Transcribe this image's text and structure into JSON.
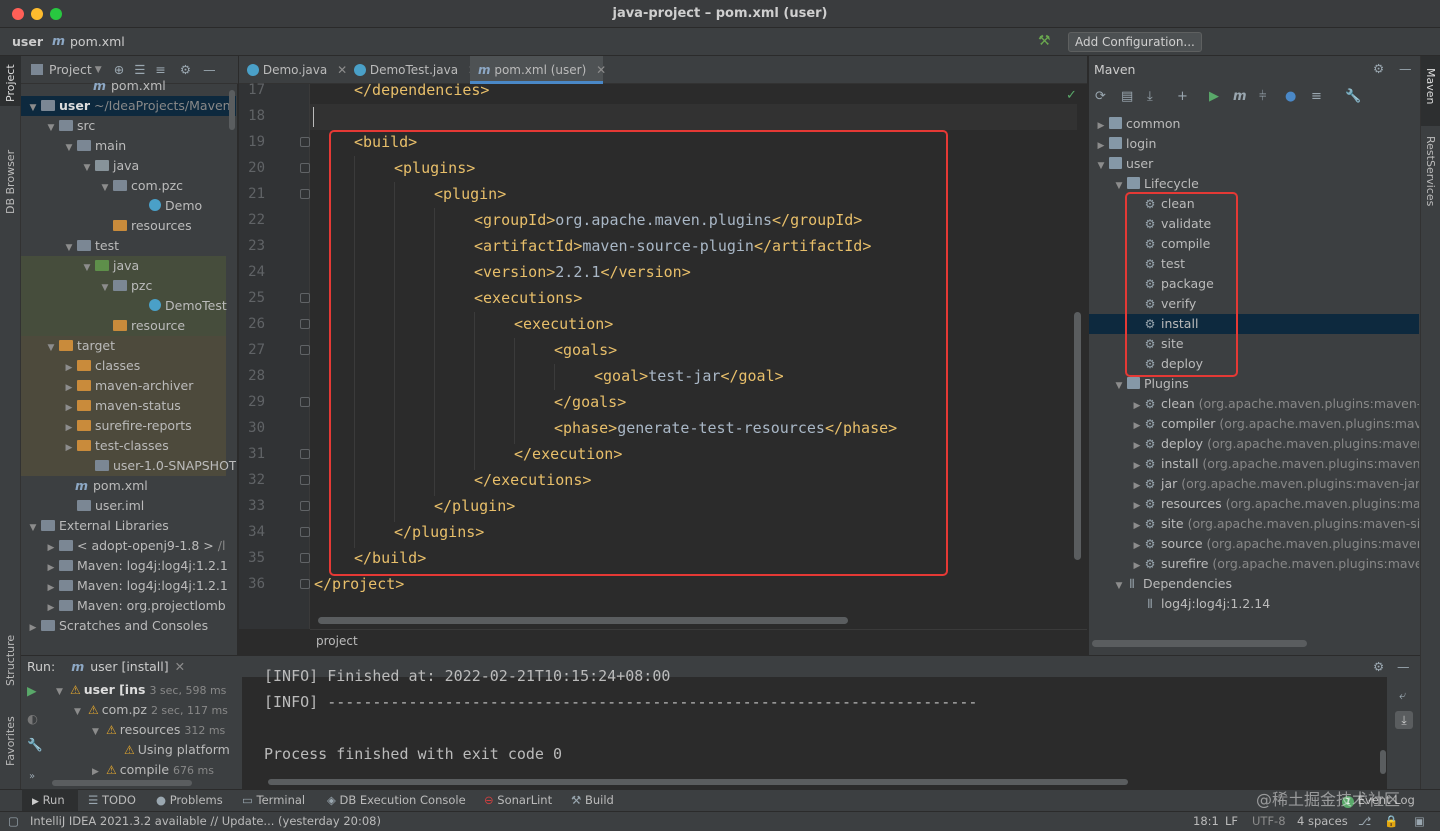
{
  "window": {
    "title": "java-project – pom.xml (user)"
  },
  "navbar": {
    "project": "user",
    "file": "pom.xml",
    "add_configuration": "Add Configuration..."
  },
  "left_stripe": {
    "project": "Project",
    "db_browser": "DB Browser",
    "structure": "Structure",
    "favorites": "Favorites"
  },
  "project_panel": {
    "title": "Project",
    "items": [
      {
        "label": "pom.xml",
        "extra": ""
      },
      {
        "label": "user",
        "extra": "~/IdeaProjects/Maven"
      },
      {
        "label": "src",
        "extra": ""
      },
      {
        "label": "main",
        "extra": ""
      },
      {
        "label": "java",
        "extra": ""
      },
      {
        "label": "com.pzc",
        "extra": ""
      },
      {
        "label": "Demo",
        "extra": ""
      },
      {
        "label": "resources",
        "extra": ""
      },
      {
        "label": "test",
        "extra": ""
      },
      {
        "label": "java",
        "extra": ""
      },
      {
        "label": "pzc",
        "extra": ""
      },
      {
        "label": "DemoTest",
        "extra": ""
      },
      {
        "label": "resource",
        "extra": ""
      },
      {
        "label": "target",
        "extra": ""
      },
      {
        "label": "classes",
        "extra": ""
      },
      {
        "label": "maven-archiver",
        "extra": ""
      },
      {
        "label": "maven-status",
        "extra": ""
      },
      {
        "label": "surefire-reports",
        "extra": ""
      },
      {
        "label": "test-classes",
        "extra": ""
      },
      {
        "label": "user-1.0-SNAPSHOT",
        "extra": ""
      },
      {
        "label": "pom.xml",
        "extra": ""
      },
      {
        "label": "user.iml",
        "extra": ""
      },
      {
        "label": "External Libraries",
        "extra": ""
      },
      {
        "label": "< adopt-openj9-1.8 >",
        "extra": "/l"
      },
      {
        "label": "Maven: log4j:log4j:1.2.1",
        "extra": ""
      },
      {
        "label": "Maven: log4j:log4j:1.2.1",
        "extra": ""
      },
      {
        "label": "Maven: org.projectlomb",
        "extra": ""
      },
      {
        "label": "Scratches and Consoles",
        "extra": ""
      }
    ]
  },
  "editor": {
    "tabs": [
      {
        "label": "Demo.java"
      },
      {
        "label": "DemoTest.java"
      },
      {
        "label": "pom.xml (user)"
      }
    ],
    "lines": [
      {
        "n": "17",
        "text": "</dependencies>"
      },
      {
        "n": "18",
        "text": ""
      },
      {
        "n": "19",
        "text": "<build>"
      },
      {
        "n": "20",
        "text": "<plugins>"
      },
      {
        "n": "21",
        "text": "<plugin>"
      },
      {
        "n": "22",
        "text": "<groupId>org.apache.maven.plugins</groupId>"
      },
      {
        "n": "23",
        "text": "<artifactId>maven-source-plugin</artifactId>"
      },
      {
        "n": "24",
        "text": "<version>2.2.1</version>"
      },
      {
        "n": "25",
        "text": "<executions>"
      },
      {
        "n": "26",
        "text": "<execution>"
      },
      {
        "n": "27",
        "text": "<goals>"
      },
      {
        "n": "28",
        "text": "<goal>test-jar</goal>"
      },
      {
        "n": "29",
        "text": "</goals>"
      },
      {
        "n": "30",
        "text": "<phase>generate-test-resources</phase>"
      },
      {
        "n": "31",
        "text": "</execution>"
      },
      {
        "n": "32",
        "text": "</executions>"
      },
      {
        "n": "33",
        "text": "</plugin>"
      },
      {
        "n": "34",
        "text": "</plugins>"
      },
      {
        "n": "35",
        "text": "</build>"
      },
      {
        "n": "36",
        "text": "</project>"
      }
    ],
    "breadcrumb": "project"
  },
  "maven": {
    "title": "Maven",
    "projects": [
      "common",
      "login",
      "user"
    ],
    "lifecycle_label": "Lifecycle",
    "lifecycle": [
      "clean",
      "validate",
      "compile",
      "test",
      "package",
      "verify",
      "install",
      "site",
      "deploy"
    ],
    "selected_lifecycle": "install",
    "plugins_label": "Plugins",
    "plugins": [
      {
        "name": "clean",
        "detail": "(org.apache.maven.plugins:maven-c"
      },
      {
        "name": "compiler",
        "detail": "(org.apache.maven.plugins:mave"
      },
      {
        "name": "deploy",
        "detail": "(org.apache.maven.plugins:maven"
      },
      {
        "name": "install",
        "detail": "(org.apache.maven.plugins:maven-"
      },
      {
        "name": "jar",
        "detail": "(org.apache.maven.plugins:maven-jar-"
      },
      {
        "name": "resources",
        "detail": "(org.apache.maven.plugins:mav"
      },
      {
        "name": "site",
        "detail": "(org.apache.maven.plugins:maven-sit"
      },
      {
        "name": "source",
        "detail": "(org.apache.maven.plugins:maven"
      },
      {
        "name": "surefire",
        "detail": "(org.apache.maven.plugins:maven"
      }
    ],
    "dependencies_label": "Dependencies",
    "dependencies": [
      "log4j:log4j:1.2.14"
    ]
  },
  "right_stripe": {
    "maven": "Maven",
    "rest": "RestServices"
  },
  "run": {
    "label": "Run:",
    "tab": "user [install]",
    "tree": [
      {
        "label": "user [ins",
        "time": "3 sec, 598 ms"
      },
      {
        "label": "com.pz",
        "time": "2 sec, 117 ms"
      },
      {
        "label": "resources",
        "time": "312 ms"
      },
      {
        "label": "Using platform",
        "time": ""
      },
      {
        "label": "compile",
        "time": "676 ms"
      }
    ],
    "console": [
      "[INFO] Finished at: 2022-02-21T10:15:24+08:00",
      "[INFO] ------------------------------------------------------------------------",
      "",
      "Process finished with exit code 0"
    ]
  },
  "toolwindows": [
    "Run",
    "TODO",
    "Problems",
    "Terminal",
    "DB Execution Console",
    "SonarLint",
    "Build",
    "Event Log"
  ],
  "status": {
    "message": "IntelliJ IDEA 2021.3.2 available // Update... (yesterday 20:08)",
    "position": "18:1",
    "line_sep": "LF",
    "encoding": "UTF-8",
    "indent": "4 spaces",
    "watermark": "@稀土掘金技术社区"
  }
}
